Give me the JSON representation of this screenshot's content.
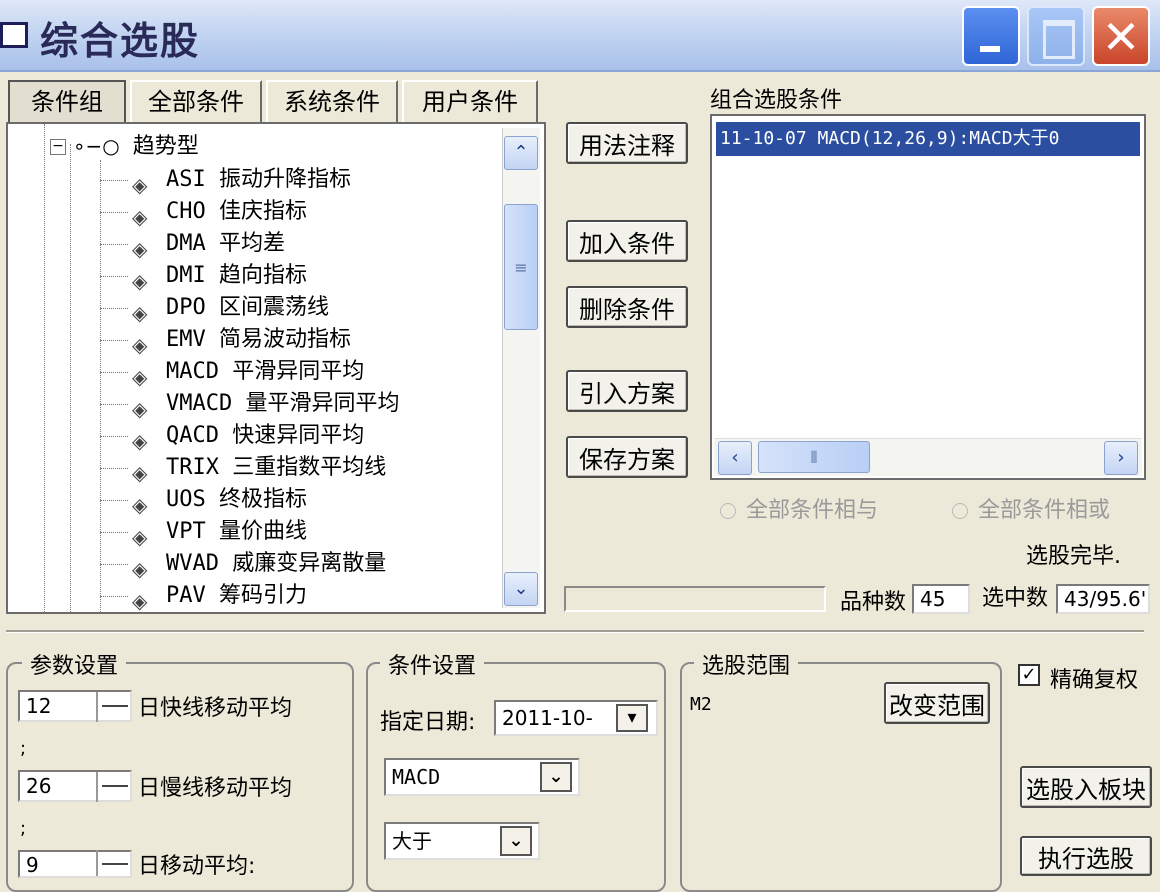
{
  "window": {
    "title": "综合选股"
  },
  "tabs": [
    {
      "label": "条件组",
      "active": true
    },
    {
      "label": "全部条件",
      "active": false
    },
    {
      "label": "系统条件",
      "active": false
    },
    {
      "label": "用户条件",
      "active": false
    }
  ],
  "tree": {
    "root_label": "趋势型",
    "items": [
      {
        "label": "ASI 振动升降指标"
      },
      {
        "label": "CHO 佳庆指标"
      },
      {
        "label": "DMA 平均差"
      },
      {
        "label": "DMI 趋向指标"
      },
      {
        "label": "DPO 区间震荡线"
      },
      {
        "label": "EMV 简易波动指标"
      },
      {
        "label": "MACD 平滑异同平均"
      },
      {
        "label": "VMACD 量平滑异同平均"
      },
      {
        "label": "QACD 快速异同平均"
      },
      {
        "label": "TRIX 三重指数平均线"
      },
      {
        "label": "UOS 终极指标"
      },
      {
        "label": "VPT 量价曲线"
      },
      {
        "label": "WVAD 威廉变异离散量"
      },
      {
        "label": "PAV 筹码引力"
      }
    ]
  },
  "middle_buttons": {
    "usage_note": "用法注释",
    "add_condition": "加入条件",
    "delete_condition": "删除条件",
    "import_plan": "引入方案",
    "save_plan": "保存方案"
  },
  "conditions_panel": {
    "title": "组合选股条件",
    "selected_item": "11-10-07 MACD(12,26,9):MACD大于0",
    "radio_and": "全部条件相与",
    "radio_or": "全部条件相或",
    "status": "选股完毕."
  },
  "stats": {
    "count_label": "品种数",
    "count_value": "45",
    "selected_label": "选中数",
    "selected_value": "43/95.6'"
  },
  "params_group": {
    "title": "参数设置",
    "params": [
      {
        "value": "12",
        "label": "日快线移动平均"
      },
      {
        "value": "26",
        "label": "日慢线移动平均"
      },
      {
        "value": "9",
        "label": "日移动平均:"
      }
    ],
    "separator": ";"
  },
  "condition_group": {
    "title": "条件设置",
    "date_label": "指定日期:",
    "date_value": "2011-10-",
    "indicator_value": "MACD",
    "compare_value": "大于"
  },
  "range_group": {
    "title": "选股范围",
    "range_value": "M2",
    "change_button": "改变范围"
  },
  "right_controls": {
    "exact_rights_label": "精确复权",
    "exact_rights_checked": true,
    "to_block_button": "选股入板块",
    "execute_button": "执行选股"
  }
}
